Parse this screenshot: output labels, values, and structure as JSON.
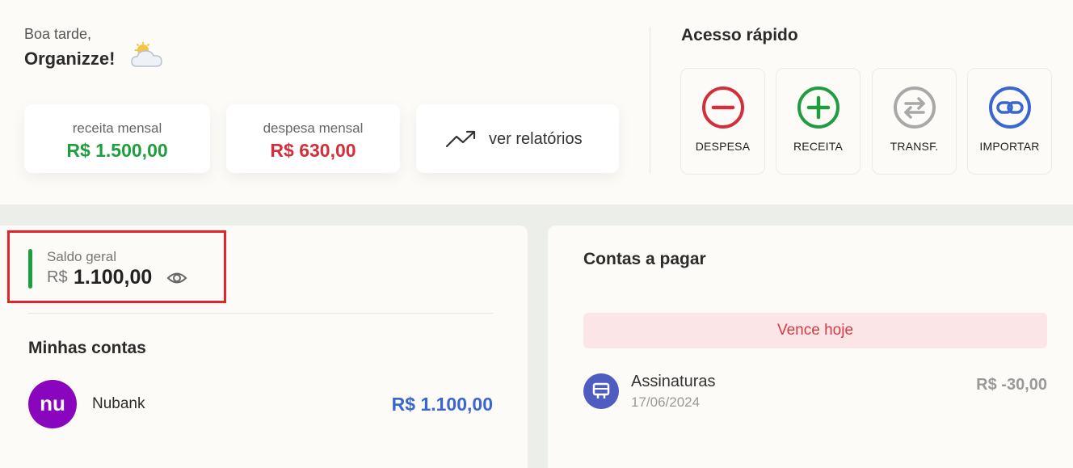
{
  "greeting": {
    "small": "Boa tarde,",
    "name": "Organizze!",
    "weather_icon": "cloud-sun-icon"
  },
  "summary": {
    "receita": {
      "label": "receita mensal",
      "value": "R$ 1.500,00",
      "color": "#1f9d3f"
    },
    "despesa": {
      "label": "despesa mensal",
      "value": "R$ 630,00",
      "color": "#d12f3a"
    },
    "relatorios": {
      "label": "ver relatórios",
      "icon": "trending-up-icon"
    }
  },
  "quick": {
    "title": "Acesso rápido",
    "buttons": [
      {
        "label": "DESPESA",
        "icon": "minus-circle-icon",
        "color": "#d12f3a"
      },
      {
        "label": "RECEITA",
        "icon": "plus-circle-icon",
        "color": "#1f9d3f"
      },
      {
        "label": "TRANSF.",
        "icon": "transfer-icon",
        "color": "#a8a8a8"
      },
      {
        "label": "IMPORTAR",
        "icon": "link-icon",
        "color": "#3a66d0"
      }
    ]
  },
  "saldo": {
    "label": "Saldo geral",
    "currency": "R$",
    "value": "1.100,00",
    "accent": "#1f9d3f",
    "icon": "eye-icon"
  },
  "contas": {
    "title": "Minhas contas",
    "items": [
      {
        "name": "Nubank",
        "logo_text": "nu",
        "value": "R$ 1.100,00",
        "color": "#3a66d0"
      }
    ]
  },
  "pagar": {
    "title": "Contas a pagar",
    "banner": "Vence hoje",
    "items": [
      {
        "name": "Assinaturas",
        "date": "17/06/2024",
        "value": "R$ -30,00",
        "icon": "ticket-icon"
      }
    ]
  }
}
